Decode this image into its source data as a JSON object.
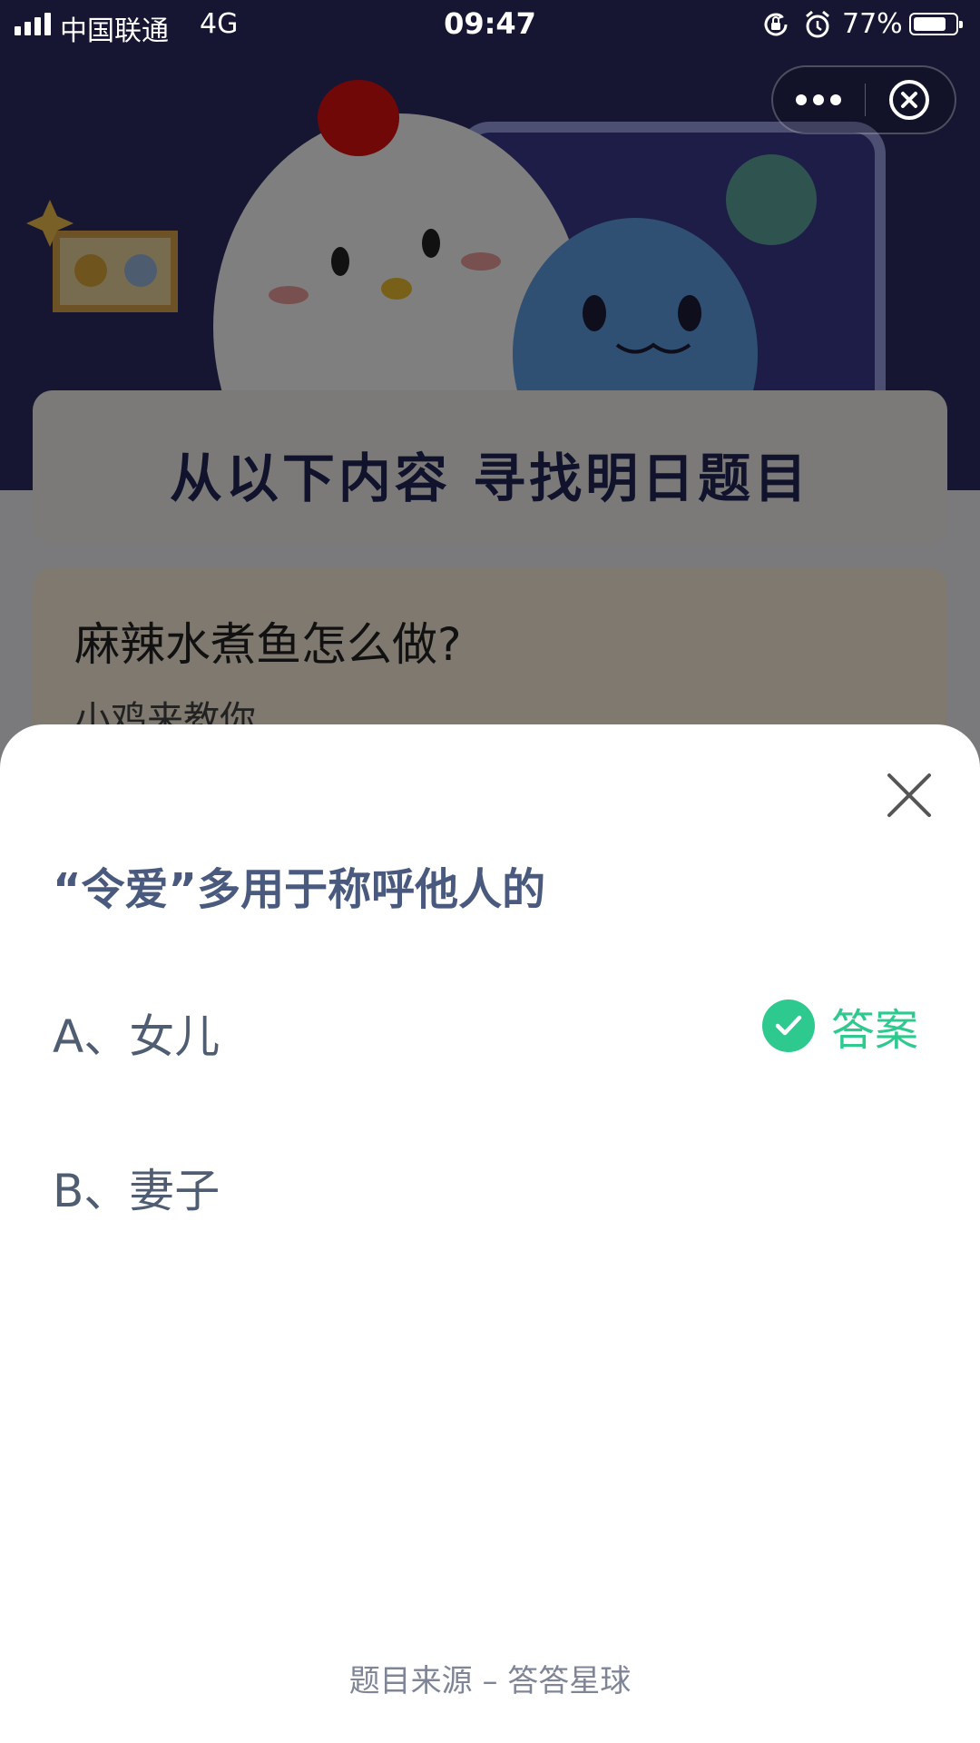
{
  "status_bar": {
    "carrier": "中国联通",
    "network": "4G",
    "time": "09:47",
    "battery_percent": "77%",
    "battery_level": 0.77,
    "icons": [
      "signal-icon",
      "orientation-lock-icon",
      "alarm-icon",
      "battery-icon"
    ]
  },
  "capsule": {
    "icons": [
      "more-dots-icon",
      "close-circle-icon"
    ]
  },
  "background_page": {
    "banner_title": "从以下内容 寻找明日题目",
    "article_title": "麻辣水煮鱼怎么做?",
    "article_subtitle": "小鸡来教你"
  },
  "quiz_sheet": {
    "question": "“令爱”多用于称呼他人的",
    "options": [
      {
        "label": "A、女儿",
        "is_answer": true
      },
      {
        "label": "B、妻子",
        "is_answer": false
      }
    ],
    "answer_label": "答案",
    "source": "题目来源 – 答答星球",
    "accent_color": "#2ec98e"
  }
}
